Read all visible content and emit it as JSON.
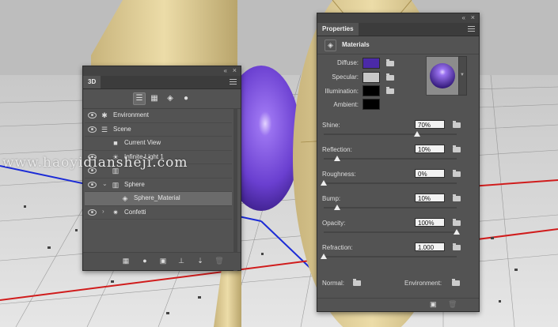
{
  "panel_3d": {
    "tab": "3D",
    "filters": [
      "scene-filter",
      "mesh-filter",
      "material-filter",
      "light-filter"
    ],
    "tree": [
      {
        "label": "Environment",
        "icon": "environment-icon",
        "indent": 0
      },
      {
        "label": "Scene",
        "icon": "scene-icon",
        "indent": 0
      },
      {
        "label": "Current View",
        "icon": "camera-icon",
        "indent": 1
      },
      {
        "label": "Infinite Light 1",
        "icon": "light-icon",
        "indent": 1
      },
      {
        "label": "",
        "icon": "mesh-icon",
        "indent": 0
      },
      {
        "label": "Sphere",
        "icon": "mesh-icon",
        "indent": 1,
        "expanded": true
      },
      {
        "label": "Sphere_Material",
        "icon": "material-icon",
        "indent": 2,
        "selected": true
      },
      {
        "label": "Confetti",
        "icon": "confetti-icon",
        "indent": 1,
        "collapsed": true
      }
    ],
    "bottom_icons": [
      "render-icon",
      "light-add-icon",
      "new-scene-icon",
      "ground-icon",
      "new-object-icon",
      "delete-icon"
    ]
  },
  "panel_properties": {
    "tab": "Properties",
    "section": "Materials",
    "colors": [
      {
        "label": "Diffuse:",
        "color": "#4b2aa8"
      },
      {
        "label": "Specular:",
        "color": "#c8c8c8"
      },
      {
        "label": "Illumination:",
        "color": "#000000"
      },
      {
        "label": "Ambient:",
        "color": "#000000"
      }
    ],
    "sliders": [
      {
        "label": "Shine:",
        "value": "70%",
        "fraction": 0.7
      },
      {
        "label": "Reflection:",
        "value": "10%",
        "fraction": 0.1
      },
      {
        "label": "Roughness:",
        "value": "0%",
        "fraction": 0.0
      },
      {
        "label": "Bump:",
        "value": "10%",
        "fraction": 0.1
      },
      {
        "label": "Opacity:",
        "value": "100%",
        "fraction": 1.0
      },
      {
        "label": "Refraction:",
        "value": "1.000",
        "fraction": 0.0
      }
    ],
    "normal_label": "Normal:",
    "environment_label": "Environment:"
  },
  "watermark": "www.haoyidiansheji.com",
  "theme": {
    "sphere_color": "#6a3fd0",
    "shape_color": "#ddca92"
  }
}
